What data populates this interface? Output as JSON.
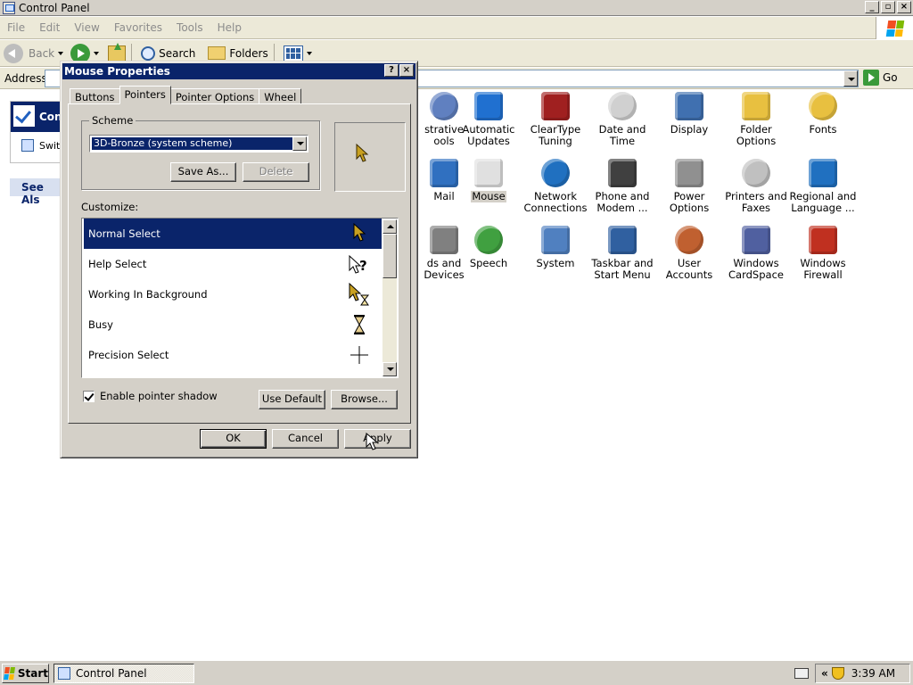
{
  "window": {
    "title": "Control Panel"
  },
  "menubar": {
    "items": [
      "File",
      "Edit",
      "View",
      "Favorites",
      "Tools",
      "Help"
    ]
  },
  "toolbar": {
    "back": "Back",
    "search": "Search",
    "folders": "Folders"
  },
  "address": {
    "label": "Address",
    "go": "Go"
  },
  "leftpane": {
    "header": "Cont",
    "switch_link": "Swit",
    "see_also": "See Als"
  },
  "icons": [
    {
      "label": "strative\nools",
      "icon": "admin-tools-icon"
    },
    {
      "label": "Automatic\nUpdates",
      "icon": "automatic-updates-icon"
    },
    {
      "label": "ClearType\nTuning",
      "icon": "cleartype-icon"
    },
    {
      "label": "Date and Time",
      "icon": "date-time-icon"
    },
    {
      "label": "Display",
      "icon": "display-icon"
    },
    {
      "label": "Folder Options",
      "icon": "folder-options-icon"
    },
    {
      "label": "Fonts",
      "icon": "fonts-icon"
    },
    {
      "label": "Mail",
      "icon": "mail-icon"
    },
    {
      "label": "Mouse",
      "icon": "mouse-icon"
    },
    {
      "label": "Network\nConnections",
      "icon": "network-icon"
    },
    {
      "label": "Phone and\nModem ...",
      "icon": "phone-modem-icon"
    },
    {
      "label": "Power Options",
      "icon": "power-options-icon"
    },
    {
      "label": "Printers and\nFaxes",
      "icon": "printers-icon"
    },
    {
      "label": "Regional and\nLanguage ...",
      "icon": "regional-icon"
    },
    {
      "label": "ds and\nDevices",
      "icon": "sounds-icon"
    },
    {
      "label": "Speech",
      "icon": "speech-icon"
    },
    {
      "label": "System",
      "icon": "system-icon"
    },
    {
      "label": "Taskbar and\nStart Menu",
      "icon": "taskbar-icon"
    },
    {
      "label": "User Accounts",
      "icon": "user-accounts-icon"
    },
    {
      "label": "Windows\nCardSpace",
      "icon": "cardspace-icon"
    },
    {
      "label": "Windows\nFirewall",
      "icon": "firewall-icon"
    }
  ],
  "dialog": {
    "title": "Mouse Properties",
    "tabs": [
      "Buttons",
      "Pointers",
      "Pointer Options",
      "Wheel"
    ],
    "active_tab": "Pointers",
    "scheme_label": "Scheme",
    "scheme_value": "3D-Bronze (system scheme)",
    "save_as": "Save As...",
    "delete": "Delete",
    "customize_label": "Customize:",
    "cursors": [
      "Normal Select",
      "Help Select",
      "Working In Background",
      "Busy",
      "Precision Select"
    ],
    "selected_cursor": "Normal Select",
    "shadow_label": "Enable pointer shadow",
    "shadow_checked": true,
    "use_default": "Use Default",
    "browse": "Browse...",
    "ok": "OK",
    "cancel": "Cancel",
    "apply": "Apply"
  },
  "taskbar": {
    "start": "Start",
    "task": "Control Panel",
    "clock": "3:39 AM"
  },
  "colors": {
    "selection": "#0a246a",
    "face": "#d4d0c8",
    "cursor_bronze": "#c8a020"
  }
}
